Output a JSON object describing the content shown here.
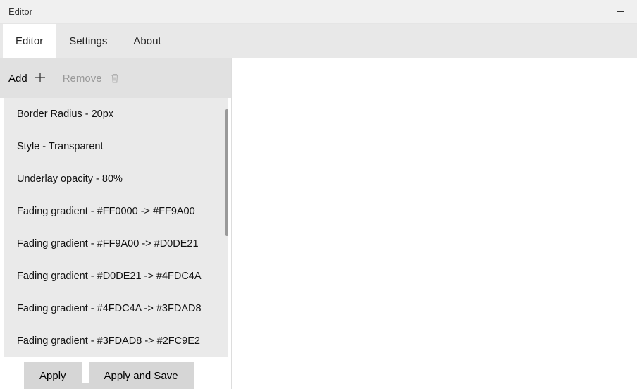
{
  "window": {
    "title": "Editor"
  },
  "tabs": [
    {
      "label": "Editor",
      "active": true
    },
    {
      "label": "Settings",
      "active": false
    },
    {
      "label": "About",
      "active": false
    }
  ],
  "toolbar": {
    "add_label": "Add",
    "remove_label": "Remove"
  },
  "list": {
    "items": [
      "Border Radius - 20px",
      "Style - Transparent",
      "Underlay opacity - 80%",
      "Fading gradient - #FF0000 -> #FF9A00",
      "Fading gradient - #FF9A00 -> #D0DE21",
      "Fading gradient - #D0DE21 -> #4FDC4A",
      "Fading gradient - #4FDC4A -> #3FDAD8",
      "Fading gradient - #3FDAD8 -> #2FC9E2"
    ]
  },
  "actions": {
    "apply_label": "Apply",
    "apply_save_label": "Apply and Save"
  }
}
